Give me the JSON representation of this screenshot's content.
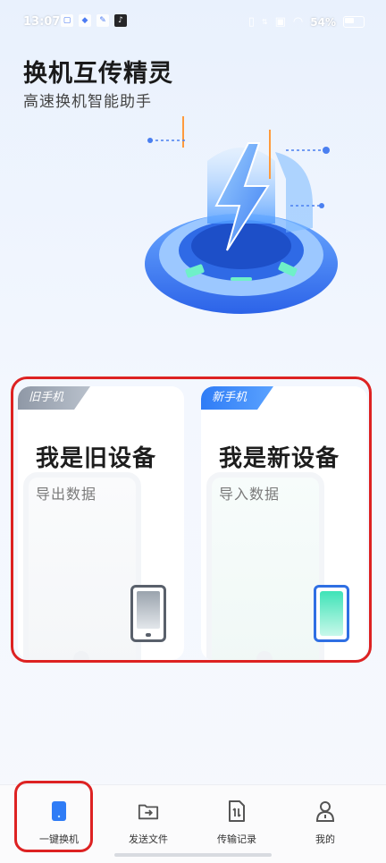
{
  "status": {
    "time": "13:07",
    "battery": "54%"
  },
  "app": {
    "title": "换机互传精灵",
    "subtitle": "高速换机智能助手"
  },
  "cards": {
    "old": {
      "tag": "旧手机",
      "title": "我是旧设备",
      "subtitle": "导出数据"
    },
    "new": {
      "tag": "新手机",
      "title": "我是新设备",
      "subtitle": "导入数据"
    }
  },
  "tabs": [
    {
      "label": "一键换机",
      "icon": "phone-icon",
      "active": true
    },
    {
      "label": "发送文件",
      "icon": "folder-send-icon",
      "active": false
    },
    {
      "label": "传输记录",
      "icon": "transfer-record-icon",
      "active": false
    },
    {
      "label": "我的",
      "icon": "user-icon",
      "active": false
    }
  ],
  "colors": {
    "accent": "#2f7cf6",
    "highlight": "#dd2222",
    "teal": "#3fe3b7"
  }
}
